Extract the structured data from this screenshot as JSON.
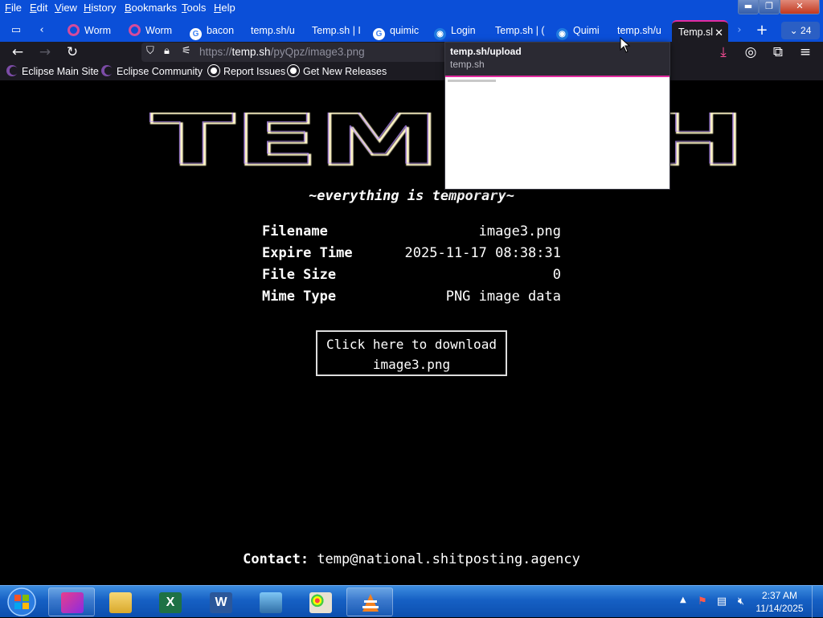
{
  "menubar": {
    "items": [
      {
        "key": "F",
        "rest": "ile"
      },
      {
        "key": "E",
        "rest": "dit"
      },
      {
        "key": "V",
        "rest": "iew"
      },
      {
        "key": "H",
        "rest": "istory"
      },
      {
        "key": "B",
        "rest": "ookmarks"
      },
      {
        "key": "T",
        "rest": "ools"
      },
      {
        "key": "H",
        "rest": "elp"
      }
    ]
  },
  "tabs": [
    {
      "label": "Worm",
      "favicon": "worm"
    },
    {
      "label": "Worm",
      "favicon": "worm"
    },
    {
      "label": "bacon",
      "favicon": "google"
    },
    {
      "label": "temp.sh/u",
      "favicon": "none"
    },
    {
      "label": "Temp.sh | I",
      "favicon": "none"
    },
    {
      "label": "quimic",
      "favicon": "google"
    },
    {
      "label": "Login",
      "favicon": "quimi"
    },
    {
      "label": "Temp.sh | (",
      "favicon": "none"
    },
    {
      "label": "Quimi",
      "favicon": "quimi"
    },
    {
      "label": "temp.sh/u",
      "favicon": "none"
    },
    {
      "label": "Temp.sl",
      "favicon": "none",
      "active": true
    }
  ],
  "tab_count": "24",
  "url": {
    "prefix": "https://",
    "host": "temp.sh",
    "path": "/pyQpz/image3.png"
  },
  "bookmarks": [
    {
      "label": "Eclipse Main Site",
      "icon": "eclipse-icon"
    },
    {
      "label": "Eclipse Community",
      "icon": "eclipse-icon"
    },
    {
      "label": "Report Issues",
      "icon": "github-icon"
    },
    {
      "label": "Get New Releases",
      "icon": "github-icon"
    }
  ],
  "tab_preview": {
    "title": "temp.sh/upload",
    "host": "temp.sh"
  },
  "page": {
    "logo_text": "TEMP.SH",
    "tagline": "~everything is temporary~",
    "info": [
      {
        "key": "Filename",
        "value": "image3.png"
      },
      {
        "key": "Expire Time",
        "value": "2025-11-17 08:38:31"
      },
      {
        "key": "File Size",
        "value": "0"
      },
      {
        "key": "Mime Type",
        "value": "PNG image data"
      }
    ],
    "download_line1": "Click here to download",
    "download_line2": "image3.png",
    "contact_label": "Contact:",
    "contact_email": "temp@national.shitposting.agency"
  },
  "taskbar": {
    "clock_time": "2:37 AM",
    "clock_date": "11/14/2025"
  },
  "colors": {
    "menubar": "#0b4fd8",
    "toolbar": "#1c1b22",
    "active_tab_accent": "#e32ba0",
    "page_bg": "#000000"
  }
}
